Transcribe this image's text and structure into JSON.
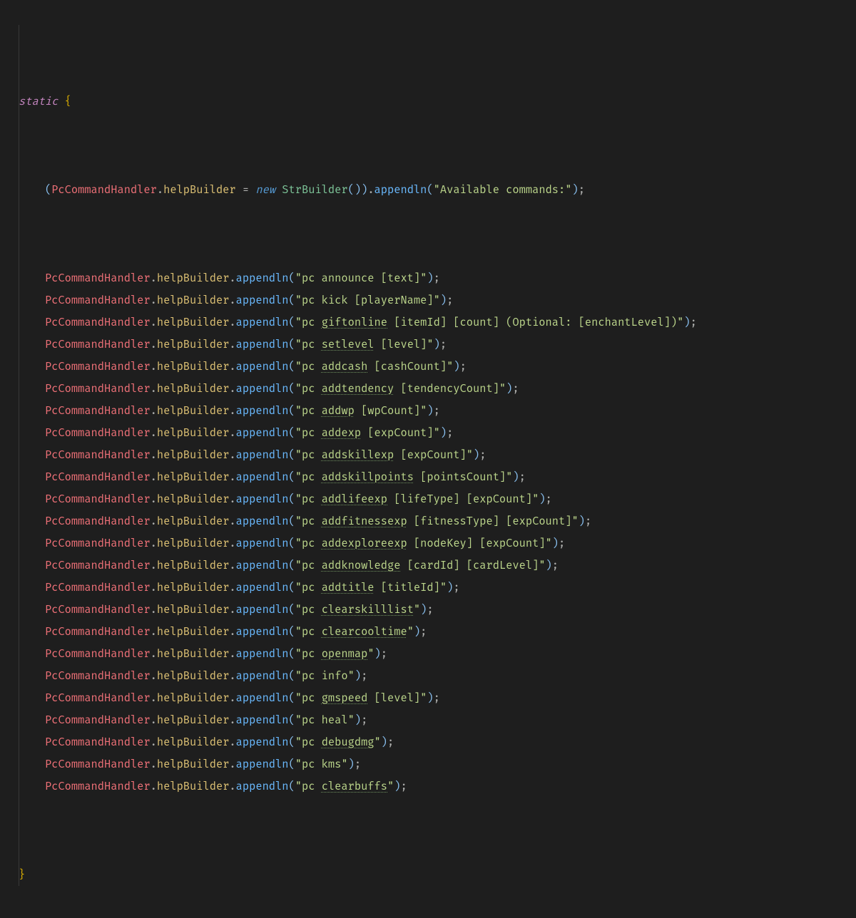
{
  "header": {
    "static_kw": "static",
    "brace_open": " {",
    "brace_close": "}"
  },
  "first": {
    "indent": "    ",
    "paren_open": "(",
    "cls": "PcCommandHandler",
    "dot": ".",
    "prop": "helpBuilder",
    "eq": " = ",
    "new_kw": "new",
    "space": " ",
    "ctor": "StrBuilder",
    "ctor_parens": "()",
    "paren_close": ")",
    "fn": "appendln",
    "arg": "\"Available commands:\"",
    "semi": ";"
  },
  "lines": [
    {
      "plain": "\"pc announce [text]\""
    },
    {
      "plain": "\"pc kick [playerName]\""
    },
    {
      "pre": "\"pc ",
      "typo": "giftonline",
      "post": " [itemId] [count] (Optional: [enchantLevel])\""
    },
    {
      "pre": "\"pc ",
      "typo": "setlevel",
      "post": " [level]\""
    },
    {
      "pre": "\"pc ",
      "typo": "addcash",
      "post": " [cashCount]\""
    },
    {
      "pre": "\"pc ",
      "typo": "addtendency",
      "post": " [tendencyCount]\""
    },
    {
      "pre": "\"pc ",
      "typo": "addwp",
      "post": " [wpCount]\""
    },
    {
      "pre": "\"pc ",
      "typo": "addexp",
      "post": " [expCount]\""
    },
    {
      "pre": "\"pc ",
      "typo": "addskillexp",
      "post": " [expCount]\""
    },
    {
      "pre": "\"pc ",
      "typo": "addskillpoints",
      "post": " [pointsCount]\""
    },
    {
      "pre": "\"pc ",
      "typo": "addlifeexp",
      "post": " [lifeType] [expCount]\""
    },
    {
      "pre": "\"pc ",
      "typo": "addfitnessexp",
      "post": " [fitnessType] [expCount]\""
    },
    {
      "pre": "\"pc ",
      "typo": "addexploreexp",
      "post": " [nodeKey] [expCount]\""
    },
    {
      "pre": "\"pc ",
      "typo": "addknowledge",
      "post": " [cardId] [cardLevel]\""
    },
    {
      "pre": "\"pc ",
      "typo": "addtitle",
      "post": " [titleId]\""
    },
    {
      "pre": "\"pc ",
      "typo": "clearskilllist",
      "post": "\""
    },
    {
      "pre": "\"pc ",
      "typo": "clearcooltime",
      "post": "\""
    },
    {
      "pre": "\"pc ",
      "typo": "openmap",
      "post": "\""
    },
    {
      "plain": "\"pc info\""
    },
    {
      "pre": "\"pc ",
      "typo": "gmspeed",
      "post": " [level]\""
    },
    {
      "plain": "\"pc heal\""
    },
    {
      "pre": "\"pc ",
      "typo": "debugdmg",
      "post": "\""
    },
    {
      "plain": "\"pc kms\""
    },
    {
      "pre": "\"pc ",
      "typo": "clearbuffs",
      "post": "\""
    }
  ],
  "call": {
    "indent": "    ",
    "cls": "PcCommandHandler",
    "dot": ".",
    "prop": "helpBuilder",
    "fn": "appendln",
    "paren_open": "(",
    "paren_close": ")",
    "semi": ";"
  }
}
